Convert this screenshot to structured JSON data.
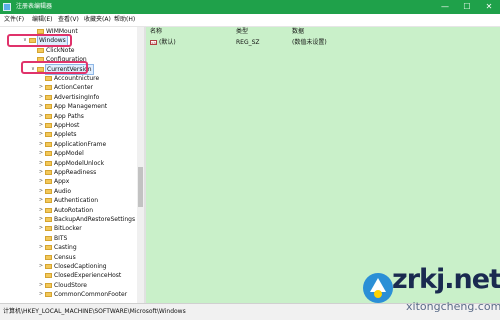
{
  "window": {
    "title": "注册表编辑器",
    "minimize": "—",
    "maximize": "☐",
    "close": "✕"
  },
  "menu": [
    "文件(F)",
    "编辑(E)",
    "查看(V)",
    "收藏夹(A)",
    "帮助(H)"
  ],
  "tree": {
    "rows": [
      {
        "label": "WIMMount",
        "expander": ""
      },
      {
        "label": "Windows",
        "expander": "∨"
      },
      {
        "label": "ClickNote",
        "expander": ""
      },
      {
        "label": "Configuration",
        "expander": ""
      },
      {
        "label": "CurrentVersion",
        "expander": "∨"
      },
      {
        "label": "Accountnicture",
        "expander": ""
      },
      {
        "label": "ActionCenter",
        "expander": ">"
      },
      {
        "label": "AdvertisingInfo",
        "expander": ">"
      },
      {
        "label": "App Management",
        "expander": ">"
      },
      {
        "label": "App Paths",
        "expander": ">"
      },
      {
        "label": "AppHost",
        "expander": ">"
      },
      {
        "label": "Applets",
        "expander": ">"
      },
      {
        "label": "ApplicationFrame",
        "expander": ">"
      },
      {
        "label": "AppModel",
        "expander": ">"
      },
      {
        "label": "AppModelUnlock",
        "expander": ">"
      },
      {
        "label": "AppReadiness",
        "expander": ">"
      },
      {
        "label": "Appx",
        "expander": ">"
      },
      {
        "label": "Audio",
        "expander": ">"
      },
      {
        "label": "Authentication",
        "expander": ">"
      },
      {
        "label": "AutoRotation",
        "expander": ">"
      },
      {
        "label": "BackupAndRestoreSettings",
        "expander": ">"
      },
      {
        "label": "BitLocker",
        "expander": ">"
      },
      {
        "label": "BITS",
        "expander": ""
      },
      {
        "label": "Casting",
        "expander": ">"
      },
      {
        "label": "Census",
        "expander": ""
      },
      {
        "label": "ClosedCaptioning",
        "expander": ">"
      },
      {
        "label": "ClosedExperienceHost",
        "expander": ""
      },
      {
        "label": "CloudStore",
        "expander": ">"
      },
      {
        "label": "CommonCommonFooter",
        "expander": ">"
      }
    ]
  },
  "values": {
    "headers": {
      "name": "名称",
      "type": "类型",
      "data": "数据"
    },
    "rows": [
      {
        "icon": "ab",
        "name": "(默认)",
        "type": "REG_SZ",
        "data": "(数值未设置)"
      }
    ]
  },
  "status": {
    "path": "计算机\\HKEY_LOCAL_MACHINE\\SOFTWARE\\Microsoft\\Windows"
  },
  "watermark": {
    "brand": "zrkj.net",
    "sub": "xitongcheng.com"
  },
  "colors": {
    "titlebar": "#1fa14a",
    "values_bg": "#c9f0c9",
    "annotation": "#e0336b"
  }
}
